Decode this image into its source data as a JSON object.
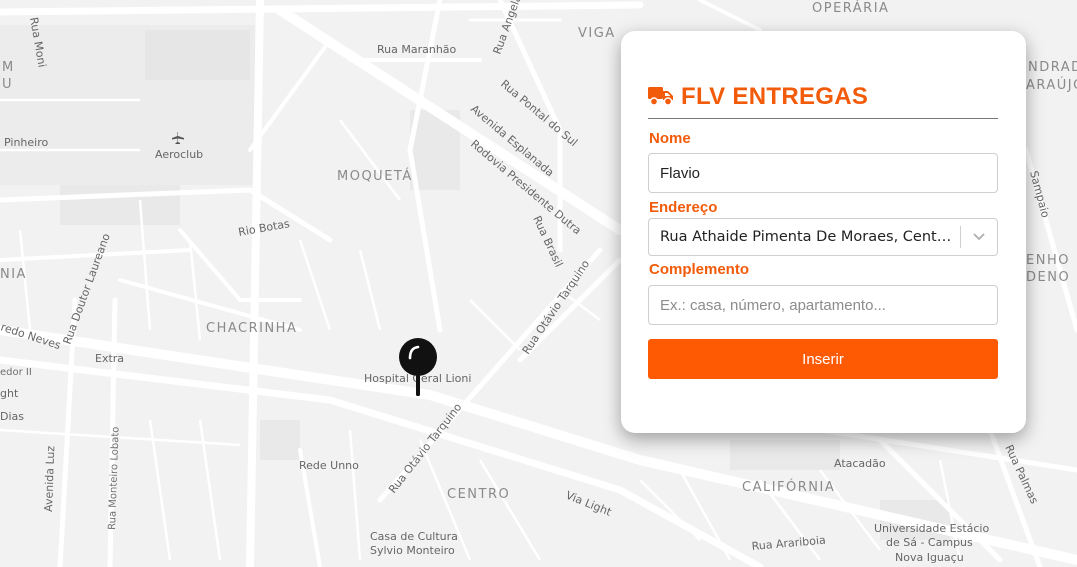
{
  "map": {
    "neighborhoods": [
      "OPERÁRIA",
      "VIGA",
      "MOQUETÁ",
      "CHACRINHA",
      "CENTRO",
      "CALIFÓRNIA",
      "M",
      "U",
      "NDRAD",
      "ARAÚJO",
      "ENHO",
      "DENO",
      "NIA"
    ],
    "streets": [
      "Rua Moni",
      "Rua Maranhão",
      "Rua Angela",
      "Rua Pontal do Sul",
      "Avenida Esplanada",
      "Rodovia Presidente Dutra",
      "Rua Brasil",
      "Rio Botas",
      "Rua Doutor Laureano",
      "Rua Otávio Tarquino",
      "Rua Otávio Tarquino",
      "Via Light",
      "Avenida Luz",
      "Rua Monteiro Lobato",
      "Rua Arariboia",
      "Rua Palmas",
      "Sampaio",
      "redo Neves",
      "Extra",
      "edor II",
      "ght",
      "Dias",
      "Pinheiro"
    ],
    "places": [
      "Aeroclub",
      "Hospital Geral Lioni",
      "Rede Unno",
      "Atacadão",
      "Casa de Cultura",
      "Sylvio Monteiro",
      "Universidade Estácio",
      "de Sá - Campus",
      "Nova Iguaçu"
    ],
    "colors": {
      "background": "#f2f2f2",
      "roads": "#ffffff",
      "blocks": "#e9e9e9",
      "pin": "#111111"
    }
  },
  "form": {
    "title": "FLV ENTREGAS",
    "name_label": "Nome",
    "name_value": "Flavio",
    "address_label": "Endereço",
    "address_value": "Rua Athaide Pimenta De Moraes, Centro, Nova Iguaçu",
    "complement_label": "Complemento",
    "complement_placeholder": "Ex.: casa, número, apartamento...",
    "submit_label": "Inserir",
    "accent_color": "#f25b09",
    "button_color": "#fe5a04",
    "icon": "truck-icon"
  }
}
